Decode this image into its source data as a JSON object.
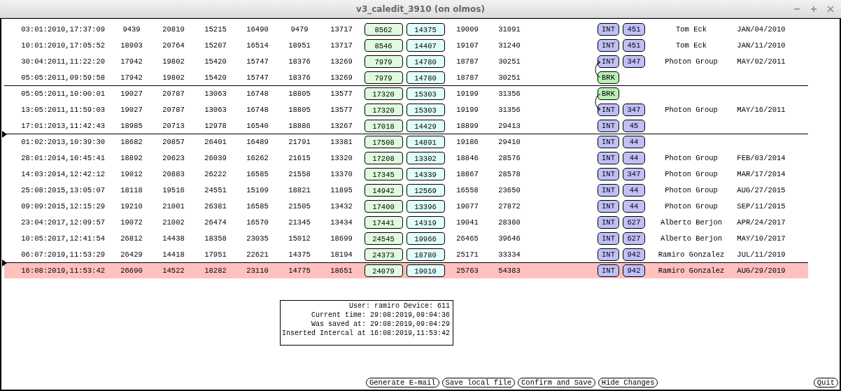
{
  "window": {
    "title": "v3_caledit_3910 (on olmos)"
  },
  "rows": [
    {
      "timestamp": "03:01:2010,17:37:09",
      "values": [
        "9439",
        "20810",
        "15215",
        "16490",
        "9479",
        "13717"
      ],
      "green": "8562",
      "cyan": "14375",
      "col_9": "19009",
      "col_10": "31091",
      "tag": "INT",
      "code": "451",
      "name": "Tom Eck",
      "date": "JAN/04/2010",
      "separator_above": false,
      "marker": false,
      "selected": false
    },
    {
      "timestamp": "10:01:2010,17:05:52",
      "values": [
        "18903",
        "20764",
        "15207",
        "16514",
        "18951",
        "13717"
      ],
      "green": "8546",
      "cyan": "14407",
      "col_9": "19107",
      "col_10": "31240",
      "tag": "INT",
      "code": "451",
      "name": "Tom Eck",
      "date": "JAN/11/2010",
      "separator_above": false,
      "marker": false,
      "selected": false
    },
    {
      "timestamp": "30:04:2011,11:22:20",
      "values": [
        "17942",
        "19802",
        "15420",
        "15747",
        "18376",
        "13269"
      ],
      "green": "7979",
      "cyan": "14780",
      "col_9": "18787",
      "col_10": "30251",
      "tag": "INT",
      "code": "347",
      "name": "Photon Group",
      "date": "MAY/02/2011",
      "separator_above": false,
      "marker": false,
      "selected": false
    },
    {
      "timestamp": "05:05:2011,09:59:58",
      "values": [
        "17942",
        "19802",
        "15420",
        "15747",
        "18376",
        "13269"
      ],
      "green": "7979",
      "cyan": "14780",
      "col_9": "18787",
      "col_10": "30251",
      "tag": "BRK",
      "linked_above": true,
      "separator_above": false,
      "marker": false,
      "selected": false
    },
    {
      "timestamp": "05:05:2011,10:00:01",
      "values": [
        "19027",
        "20787",
        "13063",
        "16748",
        "18805",
        "13577"
      ],
      "green": "17320",
      "cyan": "15303",
      "col_9": "19199",
      "col_10": "31356",
      "tag": "BRK",
      "linked_above": false,
      "separator_above": true,
      "marker": false,
      "selected": false
    },
    {
      "timestamp": "13:05:2011,11:59:03",
      "values": [
        "19027",
        "20787",
        "13063",
        "16748",
        "18805",
        "13577"
      ],
      "green": "17320",
      "cyan": "15303",
      "col_9": "19199",
      "col_10": "31356",
      "tag": "INT",
      "code": "347",
      "name": "Photon Group",
      "date": "MAY/16/2011",
      "linked_above": true,
      "separator_above": false,
      "marker": false,
      "selected": false
    },
    {
      "timestamp": "17:01:2013,11:42:43",
      "values": [
        "18985",
        "20713",
        "12978",
        "16540",
        "18886",
        "13267"
      ],
      "green": "17018",
      "cyan": "14429",
      "col_9": "18899",
      "col_10": "29413",
      "tag": "INT",
      "code": "45",
      "separator_above": false,
      "marker": false,
      "selected": false
    },
    {
      "timestamp": "01:02:2013,10:39:30",
      "values": [
        "18682",
        "20857",
        "26401",
        "16489",
        "21791",
        "13381"
      ],
      "green": "17508",
      "cyan": "14891",
      "col_9": "19186",
      "col_10": "29410",
      "tag": "INT",
      "code": "44",
      "separator_above": true,
      "marker": true,
      "selected": false
    },
    {
      "timestamp": "28:01:2014,10:45:41",
      "values": [
        "18892",
        "20623",
        "26039",
        "16262",
        "21615",
        "13320"
      ],
      "green": "17208",
      "cyan": "13302",
      "col_9": "18846",
      "col_10": "28576",
      "tag": "INT",
      "code": "44",
      "name": "Photon Group",
      "date": "FEB/03/2014",
      "separator_above": false,
      "marker": false,
      "selected": false
    },
    {
      "timestamp": "14:03:2014,12:42:12",
      "values": [
        "19012",
        "20883",
        "26222",
        "16585",
        "21558",
        "13370"
      ],
      "green": "17345",
      "cyan": "14339",
      "col_9": "18867",
      "col_10": "28578",
      "tag": "INT",
      "code": "347",
      "name": "Photon Group",
      "date": "MAR/17/2014",
      "separator_above": false,
      "marker": false,
      "selected": false
    },
    {
      "timestamp": "25:08:2015,13:05:07",
      "values": [
        "18118",
        "19516",
        "24551",
        "15109",
        "18821",
        "11895"
      ],
      "green": "14942",
      "cyan": "12569",
      "col_9": "16558",
      "col_10": "23650",
      "tag": "INT",
      "code": "44",
      "name": "Photon Group",
      "date": "AUG/27/2015",
      "separator_above": false,
      "marker": false,
      "selected": false
    },
    {
      "timestamp": "09:09:2015,12:15:29",
      "values": [
        "19210",
        "21001",
        "26381",
        "16585",
        "21505",
        "13432"
      ],
      "green": "17400",
      "cyan": "13396",
      "col_9": "19077",
      "col_10": "27872",
      "tag": "INT",
      "code": "44",
      "name": "Photon Group",
      "date": "SEP/11/2015",
      "separator_above": false,
      "marker": false,
      "selected": false
    },
    {
      "timestamp": "23:04:2017,12:09:57",
      "values": [
        "19072",
        "21002",
        "26474",
        "16570",
        "21345",
        "13434"
      ],
      "green": "17441",
      "cyan": "14319",
      "col_9": "19041",
      "col_10": "28380",
      "tag": "INT",
      "code": "627",
      "name": "Alberto Berjon",
      "date": "APR/24/2017",
      "separator_above": false,
      "marker": false,
      "selected": false
    },
    {
      "timestamp": "10:05:2017,12:41:54",
      "values": [
        "26812",
        "14438",
        "18358",
        "23035",
        "15012",
        "18699"
      ],
      "green": "24545",
      "cyan": "19966",
      "col_9": "26465",
      "col_10": "39646",
      "tag": "INT",
      "code": "627",
      "name": "Alberto Berjon",
      "date": "MAY/10/2017",
      "separator_above": false,
      "marker": false,
      "selected": false
    },
    {
      "timestamp": "06:07:2019,11:53:29",
      "values": [
        "26429",
        "14418",
        "17951",
        "22621",
        "14375",
        "18194"
      ],
      "green": "24373",
      "cyan": "18780",
      "col_9": "25171",
      "col_10": "33334",
      "tag": "INT",
      "code": "942",
      "name": "Ramiro Gonzalez",
      "date": "JUL/11/2019",
      "separator_above": false,
      "marker": false,
      "selected": false
    },
    {
      "timestamp": "16:08:2019,11:53:42",
      "values": [
        "26690",
        "14522",
        "18282",
        "23110",
        "14775",
        "18651"
      ],
      "green": "24079",
      "cyan": "19010",
      "col_9": "25763",
      "col_10": "54383",
      "tag": "INT",
      "code": "942",
      "name": "Ramiro Gonzalez",
      "date": "AUG/29/2019",
      "separator_above": true,
      "marker": true,
      "selected": true
    }
  ],
  "info": [
    "User: ramiro Device: 611",
    "Current time: 29:08:2019,09:04:36",
    "Was saved at: 29:08:2019,09:04:29",
    "Inserted Intercal at 16:08:2019,11:53:42"
  ],
  "buttons": [
    "Generate E-mail",
    "Save local file",
    "Confirm and Save",
    "Hide Changes"
  ],
  "quit_button": "Quit"
}
